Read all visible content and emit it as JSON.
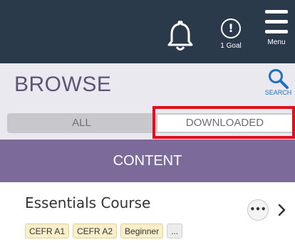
{
  "topbar": {
    "goal_count_label": "1 Goal",
    "goal_icon_glyph": "!",
    "menu_label": "Menu",
    "icons": {
      "bell": "bell-icon",
      "goal": "goal-alert-icon",
      "menu": "hamburger-menu-icon"
    },
    "bg_color": "#2b3a4b"
  },
  "browse": {
    "title": "BROWSE",
    "search_label": "SEARCH",
    "search_icon": "search-icon"
  },
  "tabs": {
    "all_label": "ALL",
    "downloaded_label": "DOWNLOADED",
    "selected": "DOWNLOADED"
  },
  "content_banner": {
    "label": "CONTENT",
    "bg_color": "#7b6a9a"
  },
  "course": {
    "title": "Essentials Course",
    "more_glyph": "•••",
    "tags": [
      "CEFR A1",
      "CEFR A2",
      "Beginner",
      "..."
    ]
  },
  "colors": {
    "accent_purple": "#7b6a9a",
    "title_purple": "#5f5476",
    "search_blue": "#1f6fbf",
    "highlight_red": "#e0101e",
    "tag_yellow": "#f8efc9"
  }
}
